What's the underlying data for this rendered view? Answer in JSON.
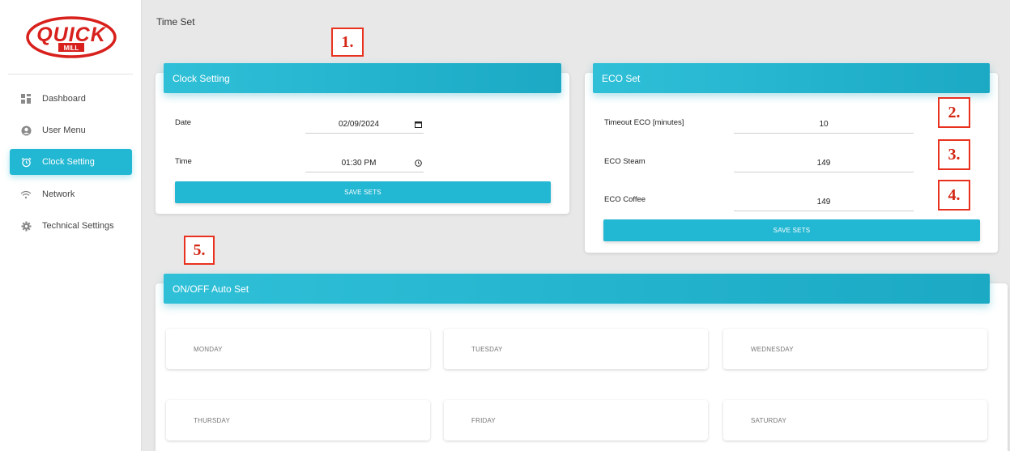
{
  "brand": {
    "logo_text": "QUICK",
    "logo_sub": "MILL",
    "accent": "#22b7d2",
    "logo_red": "#d8201c"
  },
  "sidebar": {
    "items": [
      {
        "label": "Dashboard",
        "icon": "dashboard-icon",
        "active": false
      },
      {
        "label": "User Menu",
        "icon": "user-icon",
        "active": false
      },
      {
        "label": "Clock Setting",
        "icon": "alarm-clock-icon",
        "active": true
      },
      {
        "label": "Network",
        "icon": "wifi-icon",
        "active": false
      },
      {
        "label": "Technical Settings",
        "icon": "gear-icon",
        "active": false
      }
    ]
  },
  "page": {
    "title": "Time Set"
  },
  "clock_setting": {
    "title": "Clock Setting",
    "date_label": "Date",
    "date_value": "02/09/2024",
    "time_label": "Time",
    "time_value": "01:30 PM",
    "save_label": "SAVE SETS"
  },
  "eco_set": {
    "title": "ECO Set",
    "timeout_label": "Timeout ECO [minutes]",
    "timeout_value": "10",
    "steam_label": "ECO Steam",
    "steam_value": "149",
    "coffee_label": "ECO Coffee",
    "coffee_value": "149",
    "save_label": "SAVE SETS"
  },
  "auto_set": {
    "title": "ON/OFF Auto Set",
    "days": [
      "MONDAY",
      "TUESDAY",
      "WEDNESDAY",
      "THURSDAY",
      "FRIDAY",
      "SATURDAY"
    ]
  },
  "markers": [
    "1.",
    "2.",
    "3.",
    "4.",
    "5."
  ]
}
